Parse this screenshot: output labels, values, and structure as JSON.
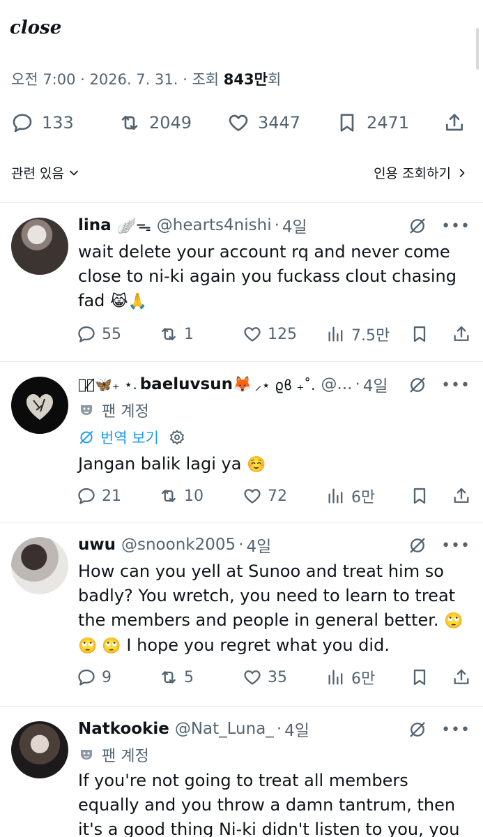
{
  "tweet": {
    "cut_text": "close",
    "time": "오전 7:00",
    "date": "2026. 7. 31.",
    "views_label": "조회",
    "views_count": "843만",
    "views_suffix": "회",
    "replies": "133",
    "retweets": "2049",
    "likes": "3447",
    "bookmarks": "2471"
  },
  "section": {
    "related_label": "관련 있음",
    "quote_views_label": "인용 조회하기"
  },
  "replies": [
    {
      "name": "lina",
      "name_emoji": "🪽ᯓ",
      "handle": "@hearts4nishi",
      "age": "4일",
      "text": "wait delete your account rq and never come close to ni-ki again you fuckass clout chasing fad",
      "text_emoji": "😹🙏",
      "stats": {
        "replies": "55",
        "retweets": "1",
        "likes": "125",
        "views": "7.5만"
      }
    },
    {
      "name_prefix": "ฅ⃝̸🦋₊ ⋆.",
      "name": "baeluvsun",
      "name_emoji": "🦊",
      "name_suffix": "⸝⋆ ϱϐ ₊˚.",
      "handle": "@...",
      "age": "4일",
      "fan_label": "팬 계정",
      "translate_label": "번역 보기",
      "text": "Jangan balik lagi ya",
      "text_emoji": "☺️",
      "stats": {
        "replies": "21",
        "retweets": "10",
        "likes": "72",
        "views": "6만"
      }
    },
    {
      "name": "uwu",
      "handle": "@snoonk2005",
      "age": "4일",
      "text": "How can you yell at Sunoo and treat him so badly? You wretch, you need to learn to treat the members and people in general better.",
      "text_emoji_1": "🙄",
      "text_emoji_2": "🙄 🙄",
      "text_tail": "I hope you regret what you did.",
      "stats": {
        "replies": "9",
        "retweets": "5",
        "likes": "35",
        "views": "6만"
      }
    },
    {
      "name": "Natkookie",
      "handle": "@Nat_Luna_",
      "age": "4일",
      "fan_label": "팬 계정",
      "text": "If you're not going to treat all members equally and you throw a damn tantrum, then it's a good thing Ni-ki didn't listen to you, you bitch."
    }
  ]
}
